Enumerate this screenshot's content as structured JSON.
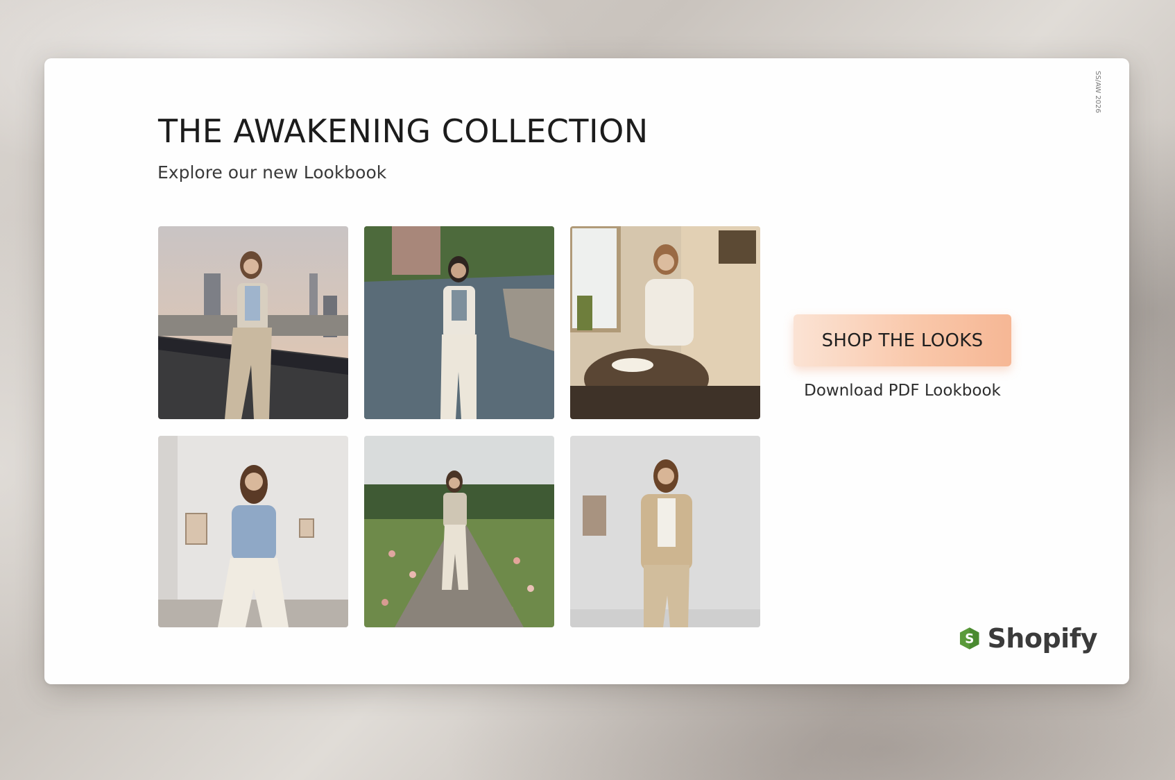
{
  "collection": {
    "title": "THE AWAKENING COLLECTION",
    "subtitle": "Explore our new Lookbook",
    "vertical_mark": "SS/AW 2026"
  },
  "lookbook": {
    "photos": [
      {
        "scene": "city-rooftop",
        "icon": "photo-model-city-rooftop"
      },
      {
        "scene": "river",
        "icon": "photo-model-river"
      },
      {
        "scene": "sunlit-cafe",
        "icon": "photo-model-cafe"
      },
      {
        "scene": "white-gallery",
        "icon": "photo-model-gallery"
      },
      {
        "scene": "flower-path",
        "icon": "photo-model-flower-path"
      },
      {
        "scene": "studio-wall",
        "icon": "photo-model-studio"
      }
    ]
  },
  "actions": {
    "shop_label": "SHOP THE LOOKS",
    "download_label": "Download PDF Lookbook"
  },
  "brand": {
    "name": "Shopify",
    "logo_color": "#5a9a3a"
  },
  "colors": {
    "cta_start": "#fbe3d4",
    "cta_end": "#f6b795",
    "text": "#1c1c1c"
  }
}
